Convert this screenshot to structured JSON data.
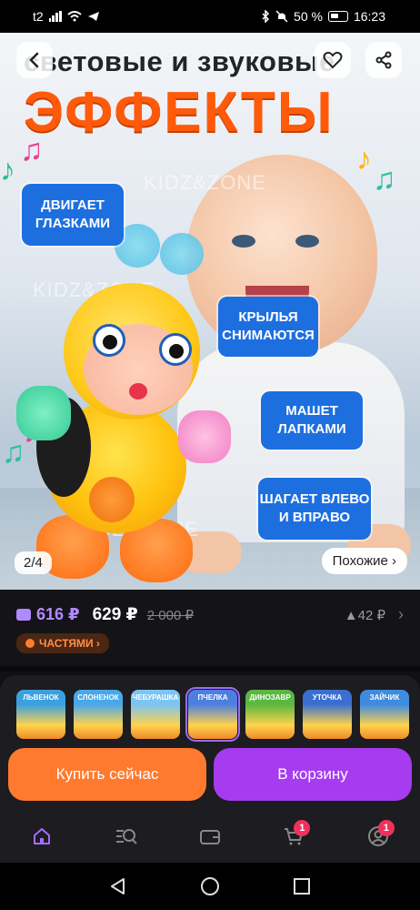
{
  "status_bar": {
    "carrier": "t2",
    "battery": "50 %",
    "time": "16:23"
  },
  "hero": {
    "title_line1": "световые и звуковые",
    "title_line2": "ЭФФЕКТЫ",
    "watermark": "KIDZ&ZONE",
    "features": [
      "ДВИГАЕТ ГЛАЗКАМИ",
      "КРЫЛЬЯ СНИМАЮТСЯ",
      "МАШЕТ ЛАПКАМИ",
      "ШАГАЕТ ВЛЕВО И ВПРАВО"
    ],
    "pager": "2/4",
    "similar_label": "Похожие ›"
  },
  "price": {
    "wallet_price": "616 ₽",
    "price": "629 ₽",
    "old_price": "2 000 ₽",
    "votes": "▲42 ₽",
    "installments_label": "ЧАСТЯМИ ›"
  },
  "variants": [
    {
      "label": "ЛЬВЕНОК",
      "color": "#3aa0e0"
    },
    {
      "label": "СЛОНЕНОК",
      "color": "#48a8e8"
    },
    {
      "label": "ЧЕБУРАШКА",
      "color": "#7cc4f2"
    },
    {
      "label": "ПЧЕЛКА",
      "color": "#4d7fe0"
    },
    {
      "label": "ДИНОЗАВР",
      "color": "#5ab840"
    },
    {
      "label": "УТОЧКА",
      "color": "#3a6fd0"
    },
    {
      "label": "ЗАЙЧИК",
      "color": "#3e8be0"
    }
  ],
  "actions": {
    "buy_now": "Купить сейчас",
    "add_to_cart": "В корзину"
  },
  "bottom_nav": {
    "cart_badge": "1",
    "profile_badge": "1"
  },
  "icons": [
    "back-icon",
    "heart-icon",
    "share-icon",
    "home-icon",
    "catalog-icon",
    "wallet-icon",
    "cart-icon",
    "profile-icon"
  ],
  "colors": {
    "accent_orange": "#ff7a2e",
    "accent_purple": "#a63bf0",
    "wallet_purple": "#b38bff",
    "badge_red": "#f0315c"
  }
}
